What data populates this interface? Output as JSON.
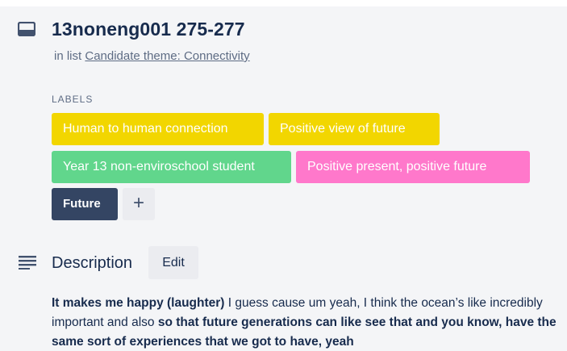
{
  "card": {
    "title": "13noneng001 275-277",
    "in_list_prefix": "in list",
    "list_name": "Candidate theme: Connectivity"
  },
  "labels": {
    "heading": "LABELS",
    "items": [
      {
        "text": "Human to human connection",
        "color": "#f2d600"
      },
      {
        "text": "Positive view of future",
        "color": "#f2d600"
      },
      {
        "text": "Year 13 non-enviroschool student",
        "color": "#61d68c"
      },
      {
        "text": "Positive present, positive future",
        "color": "#ff78cb"
      },
      {
        "text": "Future",
        "color": "#344563"
      }
    ],
    "add_symbol": "+"
  },
  "description": {
    "title": "Description",
    "edit_label": "Edit",
    "segments": [
      {
        "text": "It makes me happy (laughter)",
        "bold": true
      },
      {
        "text": " I guess cause um yeah, I think the ocean’s like incredibly important and also ",
        "bold": false
      },
      {
        "text": "so that future generations can like see that and you know, have the same sort of experiences that we got to have, yeah",
        "bold": true
      }
    ]
  },
  "icons": {
    "card": "card-icon",
    "description": "description-icon"
  },
  "colors": {
    "background": "#f4f5f7",
    "text": "#172b4d",
    "muted": "#5e6c84",
    "button_bg": "#ebecf0"
  }
}
